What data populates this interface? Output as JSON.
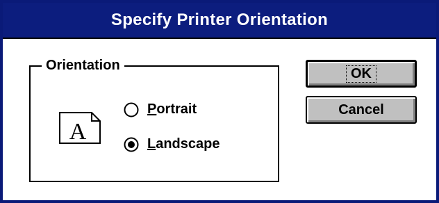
{
  "dialog": {
    "title": "Specify Printer Orientation",
    "accent_color": "#0c1d7e"
  },
  "orientation_group": {
    "legend": "Orientation",
    "icon": "landscape-page-icon",
    "icon_letter": "A",
    "selected": "landscape",
    "options": [
      {
        "id": "portrait",
        "mnemonic": "P",
        "rest": "ortrait",
        "checked": false
      },
      {
        "id": "landscape",
        "mnemonic": "L",
        "rest": "andscape",
        "checked": true
      }
    ]
  },
  "buttons": {
    "ok_label": "OK",
    "cancel_label": "Cancel"
  }
}
